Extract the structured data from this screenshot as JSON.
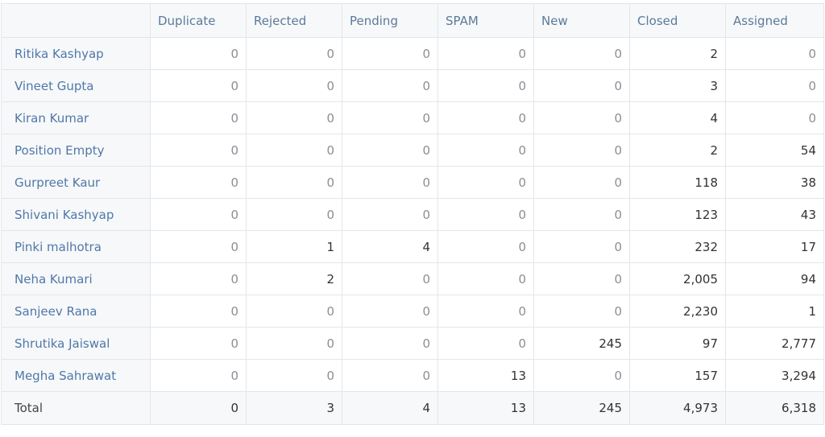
{
  "table": {
    "columns": [
      "",
      "Duplicate",
      "Rejected",
      "Pending",
      "SPAM",
      "New",
      "Closed",
      "Assigned"
    ],
    "rows": [
      {
        "name": "Ritika Kashyap",
        "values": [
          "0",
          "0",
          "0",
          "0",
          "0",
          "2",
          "0"
        ]
      },
      {
        "name": "Vineet Gupta",
        "values": [
          "0",
          "0",
          "0",
          "0",
          "0",
          "3",
          "0"
        ]
      },
      {
        "name": "Kiran Kumar",
        "values": [
          "0",
          "0",
          "0",
          "0",
          "0",
          "4",
          "0"
        ]
      },
      {
        "name": "Position Empty",
        "values": [
          "0",
          "0",
          "0",
          "0",
          "0",
          "2",
          "54"
        ]
      },
      {
        "name": "Gurpreet Kaur",
        "values": [
          "0",
          "0",
          "0",
          "0",
          "0",
          "118",
          "38"
        ]
      },
      {
        "name": "Shivani Kashyap",
        "values": [
          "0",
          "0",
          "0",
          "0",
          "0",
          "123",
          "43"
        ]
      },
      {
        "name": "Pinki malhotra",
        "values": [
          "0",
          "1",
          "4",
          "0",
          "0",
          "232",
          "17"
        ]
      },
      {
        "name": "Neha Kumari",
        "values": [
          "0",
          "2",
          "0",
          "0",
          "0",
          "2,005",
          "94"
        ]
      },
      {
        "name": "Sanjeev Rana",
        "values": [
          "0",
          "0",
          "0",
          "0",
          "0",
          "2,230",
          "1"
        ]
      },
      {
        "name": "Shrutika Jaiswal",
        "values": [
          "0",
          "0",
          "0",
          "0",
          "245",
          "97",
          "2,777"
        ]
      },
      {
        "name": "Megha Sahrawat",
        "values": [
          "0",
          "0",
          "0",
          "13",
          "0",
          "157",
          "3,294"
        ]
      }
    ],
    "total": {
      "name": "Total",
      "values": [
        "0",
        "3",
        "4",
        "13",
        "245",
        "4,973",
        "6,318"
      ]
    }
  }
}
